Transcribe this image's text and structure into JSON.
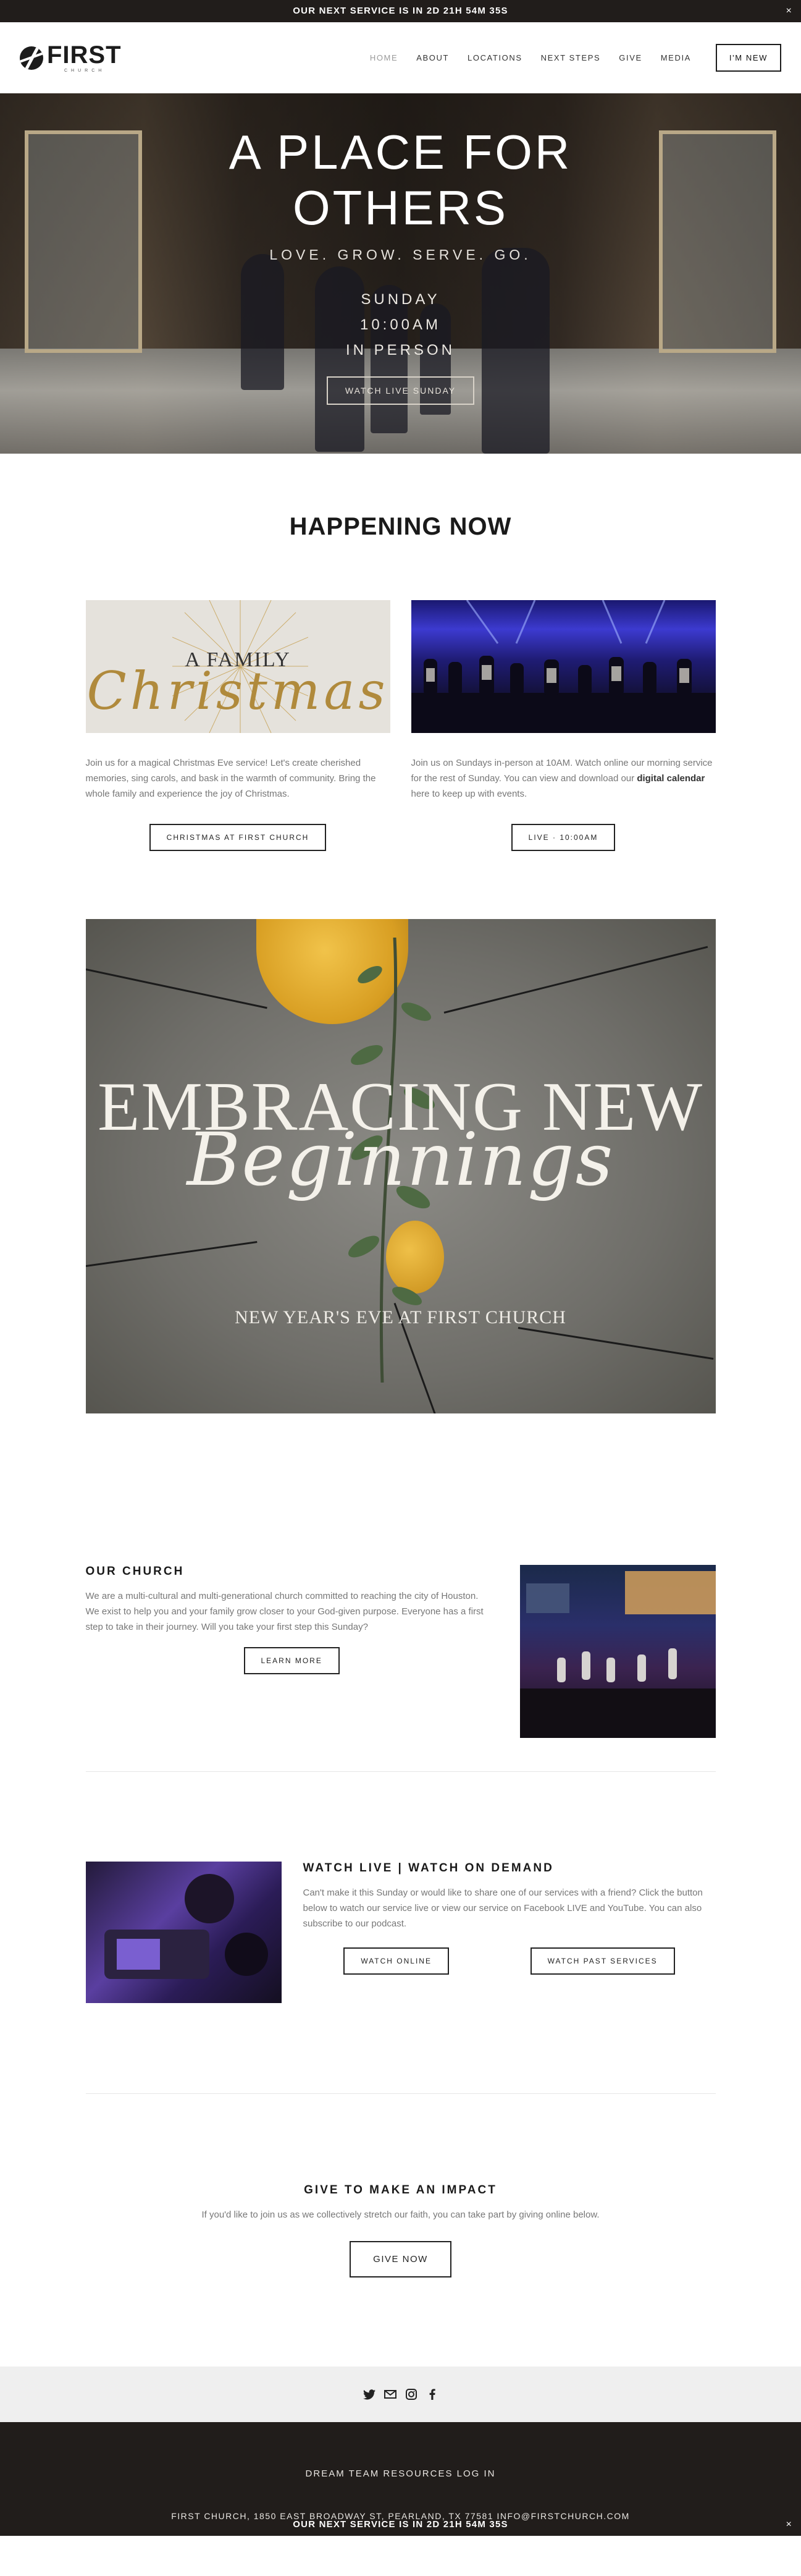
{
  "announcement": {
    "text": "OUR NEXT SERVICE IS IN 2D 21H 54M 35S",
    "close": "×"
  },
  "header": {
    "logo_text": "FIRST",
    "logo_subtext": "CHURCH",
    "nav": [
      "HOME",
      "ABOUT",
      "LOCATIONS",
      "NEXT STEPS",
      "GIVE",
      "MEDIA"
    ],
    "cta": "I'M NEW"
  },
  "hero": {
    "title_line1": "A PLACE FOR",
    "title_line2": "OTHERS",
    "tagline": "LOVE. GROW. SERVE. GO.",
    "service_day": "SUNDAY",
    "service_time": "10:00AM",
    "service_mode": "IN PERSON",
    "button": "WATCH LIVE SUNDAY"
  },
  "happening": {
    "title": "HAPPENING NOW",
    "cards": [
      {
        "image_title": "A FAMILY",
        "image_script": "Christmas",
        "text": "Join us for a magical Christmas Eve service! Let's create cherished memories, sing carols, and bask in the warmth of community. Bring the whole family and experience the joy of Christmas.",
        "button": "CHRISTMAS AT FIRST CHURCH"
      },
      {
        "text_before": "Join us on Sundays in-person at 10AM. Watch online our morning service for the rest of Sunday. You can view and download our ",
        "text_bold": "digital calendar",
        "text_after": " here to keep up with events.",
        "button": "LIVE · 10:00AM"
      }
    ]
  },
  "banner": {
    "line1": "EMBRACING NEW",
    "line2": "Beginnings",
    "line3": "NEW YEAR'S EVE AT FIRST CHURCH"
  },
  "church": {
    "title": "OUR CHURCH",
    "text": "We are a multi-cultural and multi-generational church committed to reaching the city of Houston. We exist to help you and your family grow closer to your God-given purpose. Everyone has a first step to take in their journey. Will you take your first step this Sunday?",
    "button": "LEARN MORE"
  },
  "watch": {
    "title": "WATCH LIVE | WATCH ON DEMAND",
    "text": "Can't make it this Sunday or would like to share one of our services with a friend? Click the button below to watch our service live or view our service on Facebook LIVE and YouTube. You can also subscribe to our podcast.",
    "button_online": "WATCH ONLINE",
    "button_past": "WATCH PAST SERVICES"
  },
  "give": {
    "title": "GIVE TO MAKE AN IMPACT",
    "text": "If you'd like to join us as we collectively stretch our faith, you can take part by giving online below.",
    "button": "GIVE NOW"
  },
  "social": {
    "icons": [
      "twitter-icon",
      "email-icon",
      "instagram-icon",
      "facebook-icon"
    ]
  },
  "footer": {
    "resources": "DREAM TEAM RESOURCES LOG IN",
    "address": "FIRST CHURCH, 1850 EAST BROADWAY ST, PEARLAND, TX 77581   INFO@FIRSTCHURCH.COM",
    "announcement": "OUR NEXT SERVICE IS IN 2D 21H 54M 35S"
  },
  "colors": {
    "dark": "#211d1b",
    "gold": "#d89e22",
    "light_bg": "#efefef"
  }
}
